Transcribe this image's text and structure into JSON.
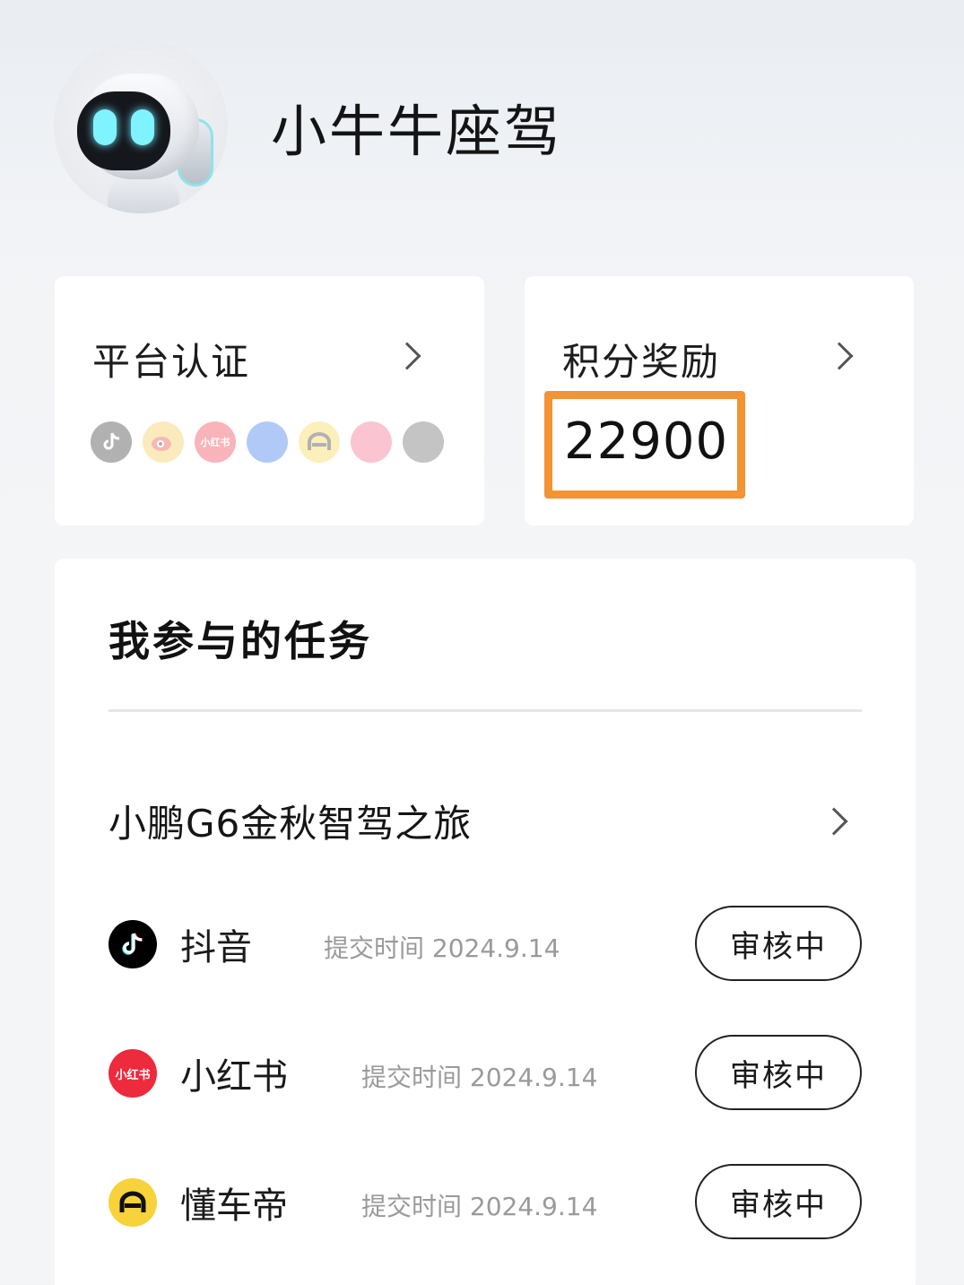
{
  "profile": {
    "name": "小牛牛座驾"
  },
  "cards": {
    "platform": {
      "title": "平台认证",
      "icons": [
        "douyin-icon",
        "weibo-icon",
        "xiaohongshu-icon",
        "autohome-icon",
        "dongchedi-icon",
        "bilibili-icon",
        "yiche-icon"
      ],
      "icon_labels": {
        "xiaohongshu": "小红书"
      }
    },
    "points": {
      "title": "积分奖励",
      "value": "22900",
      "highlight_color": "#f39333"
    }
  },
  "tasks": {
    "title": "我参与的任务",
    "campaign": "小鹏G6金秋智驾之旅",
    "items": [
      {
        "platform": "抖音",
        "time_label": "提交时间 2024.9.14",
        "status": "审核中",
        "icon": "douyin-icon",
        "icon_color": "#000000"
      },
      {
        "platform": "小红书",
        "time_label": "提交时间 2024.9.14",
        "status": "审核中",
        "icon": "xiaohongshu-icon",
        "icon_color": "#ee2a3d",
        "icon_text": "小红书"
      },
      {
        "platform": "懂车帝",
        "time_label": "提交时间 2024.9.14",
        "status": "审核中",
        "icon": "dongchedi-icon",
        "icon_color": "#f7d23a"
      }
    ]
  }
}
